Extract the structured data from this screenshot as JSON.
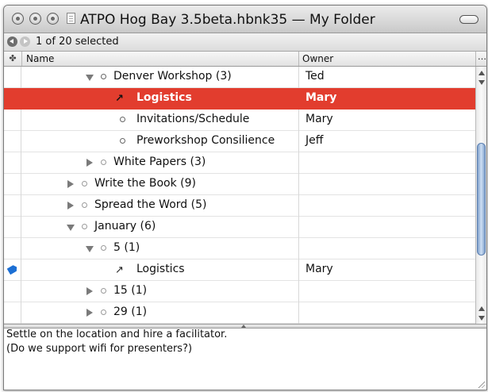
{
  "window": {
    "title": "ATPO Hog Bay 3.5beta.hbnk35 — My Folder"
  },
  "selection_bar": {
    "text": "1 of 20 selected"
  },
  "columns": {
    "badge": "✤",
    "name": "Name",
    "owner": "Owner",
    "more": "…"
  },
  "rows": [
    {
      "label": "Denver Workshop (3)",
      "owner": "Ted"
    },
    {
      "label": "Logistics",
      "owner": "Mary"
    },
    {
      "label": "Invitations/Schedule",
      "owner": "Mary"
    },
    {
      "label": "Preworkshop Consilience",
      "owner": "Jeff"
    },
    {
      "label": "White Papers (3)",
      "owner": ""
    },
    {
      "label": "Write the Book (9)",
      "owner": ""
    },
    {
      "label": "Spread the Word (5)",
      "owner": ""
    },
    {
      "label": "January (6)",
      "owner": ""
    },
    {
      "label": "5 (1)",
      "owner": ""
    },
    {
      "label": "Logistics",
      "owner": "Mary"
    },
    {
      "label": "15 (1)",
      "owner": ""
    },
    {
      "label": "29 (1)",
      "owner": ""
    }
  ],
  "notes": {
    "line1": "Settle on the location and hire a facilitator.",
    "line2": "(Do we support wifi for presenters?)"
  },
  "colors": {
    "selection": "#e23d2e",
    "flag": "#1c6fd4",
    "scroll_thumb": "#7fa0cc"
  }
}
